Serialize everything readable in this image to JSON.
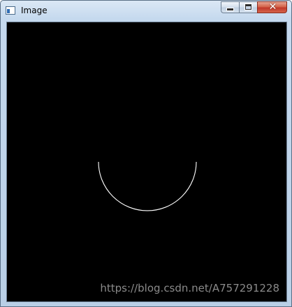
{
  "window": {
    "title": "Image"
  },
  "controls": {
    "minimize_icon": "minimize-icon",
    "maximize_icon": "maximize-icon",
    "close_glyph": "✕"
  },
  "canvas": {
    "background": "#000000",
    "stroke": "#ffffff",
    "shape": "lower-semicircle-arc"
  },
  "watermark": {
    "text": "https://blog.csdn.net/A757291228"
  }
}
